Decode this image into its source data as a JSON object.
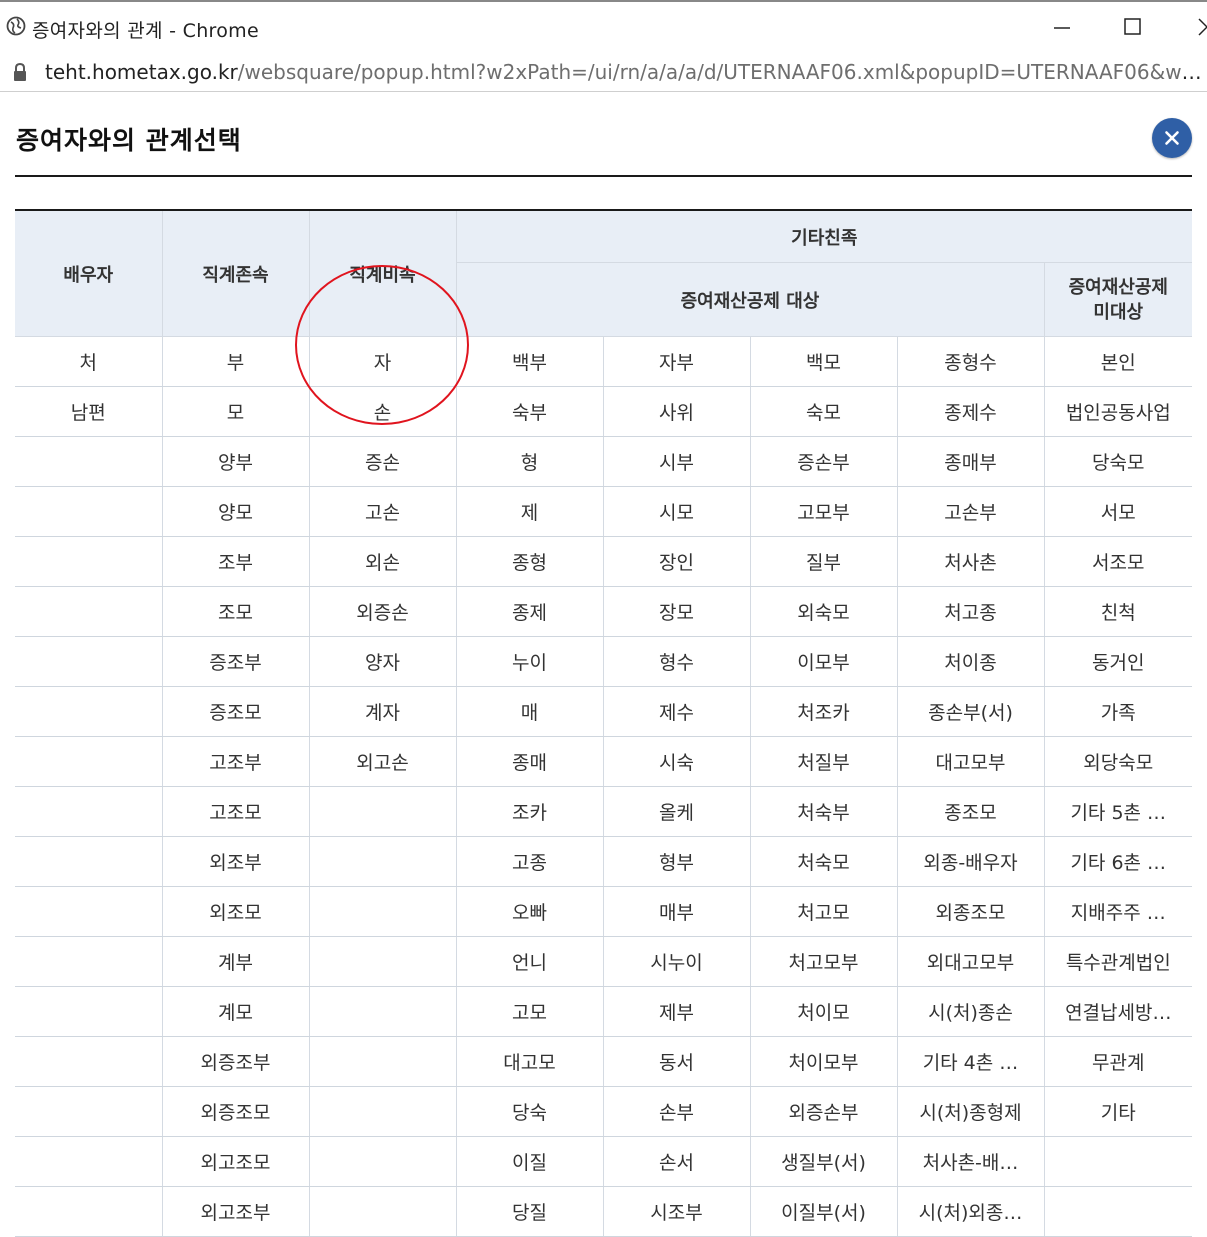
{
  "window": {
    "title": "증여자와의 관계 - Chrome",
    "url_host": "teht.hometax.go.kr",
    "url_path": "/websquare/popup.html?w2xPath=/ui/rn/a/a/a/d/UTERNAAF06.xml&popupID=UTERNAAF06&w2..."
  },
  "popup": {
    "title": "증여자와의 관계선택",
    "close_icon": "×"
  },
  "colors": {
    "header_bg": "#e8eef6",
    "close_button": "#2f5fa6",
    "annotation": "#e0141e"
  },
  "table": {
    "headers": {
      "spouse": "배우자",
      "lineal_ascendant": "직계존속",
      "lineal_descendant": "직계비속",
      "other_relatives": "기타친족",
      "deduction_target": "증여재산공제 대상",
      "non_deduction_line1": "증여재산공제",
      "non_deduction_line2": "미대상"
    },
    "rows": [
      [
        "처",
        "부",
        "자",
        "백부",
        "자부",
        "백모",
        "종형수",
        "본인"
      ],
      [
        "남편",
        "모",
        "손",
        "숙부",
        "사위",
        "숙모",
        "종제수",
        "법인공동사업"
      ],
      [
        "",
        "양부",
        "증손",
        "형",
        "시부",
        "증손부",
        "종매부",
        "당숙모"
      ],
      [
        "",
        "양모",
        "고손",
        "제",
        "시모",
        "고모부",
        "고손부",
        "서모"
      ],
      [
        "",
        "조부",
        "외손",
        "종형",
        "장인",
        "질부",
        "처사촌",
        "서조모"
      ],
      [
        "",
        "조모",
        "외증손",
        "종제",
        "장모",
        "외숙모",
        "처고종",
        "친척"
      ],
      [
        "",
        "증조부",
        "양자",
        "누이",
        "형수",
        "이모부",
        "처이종",
        "동거인"
      ],
      [
        "",
        "증조모",
        "계자",
        "매",
        "제수",
        "처조카",
        "종손부(서)",
        "가족"
      ],
      [
        "",
        "고조부",
        "외고손",
        "종매",
        "시숙",
        "처질부",
        "대고모부",
        "외당숙모"
      ],
      [
        "",
        "고조모",
        "",
        "조카",
        "올케",
        "처숙부",
        "종조모",
        "기타 5촌 …"
      ],
      [
        "",
        "외조부",
        "",
        "고종",
        "형부",
        "처숙모",
        "외종-배우자",
        "기타 6촌 …"
      ],
      [
        "",
        "외조모",
        "",
        "오빠",
        "매부",
        "처고모",
        "외종조모",
        "지배주주 …"
      ],
      [
        "",
        "계부",
        "",
        "언니",
        "시누이",
        "처고모부",
        "외대고모부",
        "특수관계법인"
      ],
      [
        "",
        "계모",
        "",
        "고모",
        "제부",
        "처이모",
        "시(처)종손",
        "연결납세방…"
      ],
      [
        "",
        "외증조부",
        "",
        "대고모",
        "동서",
        "처이모부",
        "기타 4촌 …",
        "무관계"
      ],
      [
        "",
        "외증조모",
        "",
        "당숙",
        "손부",
        "외증손부",
        "시(처)종형제",
        "기타"
      ],
      [
        "",
        "외고조모",
        "",
        "이질",
        "손서",
        "생질부(서)",
        "처사촌-배…",
        ""
      ],
      [
        "",
        "외고조부",
        "",
        "당질",
        "시조부",
        "이질부(서)",
        "시(처)외종…",
        ""
      ]
    ]
  }
}
